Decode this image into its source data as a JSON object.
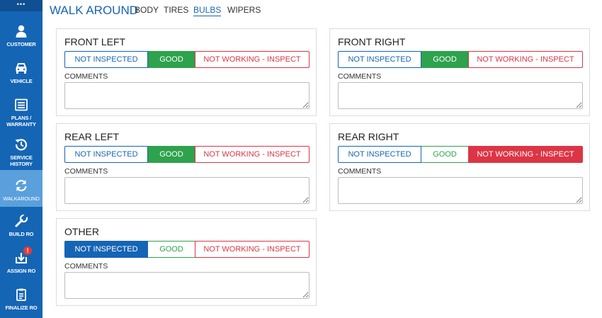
{
  "sidebar": {
    "top_glyph": "•••",
    "items": [
      {
        "label": "CUSTOMER",
        "icon": "user-icon",
        "active": false
      },
      {
        "label": "VEHICLE",
        "icon": "car-icon",
        "active": false
      },
      {
        "label": "PLANS / WARRANTY",
        "icon": "list-icon",
        "active": false
      },
      {
        "label": "SERVICE HISTORY",
        "icon": "history-icon",
        "active": false
      },
      {
        "label": "WALKAROUND",
        "icon": "refresh-icon",
        "active": true
      },
      {
        "label": "BUILD RO",
        "icon": "wrench-icon",
        "active": false
      },
      {
        "label": "ASSIGN RO",
        "icon": "download-box-icon",
        "active": false,
        "badge": "!"
      },
      {
        "label": "FINALIZE RO",
        "icon": "clipboard-icon",
        "active": false
      }
    ]
  },
  "header": {
    "title": "WALK AROUND",
    "tabs": [
      {
        "label": "BODY",
        "active": false
      },
      {
        "label": "TIRES",
        "active": false
      },
      {
        "label": "BULBS",
        "active": true
      },
      {
        "label": "WIPERS",
        "active": false
      }
    ]
  },
  "options": {
    "not_inspected": "NOT INSPECTED",
    "good": "GOOD",
    "not_working": "NOT WORKING - INSPECT"
  },
  "comments_label": "COMMENTS",
  "panels": [
    {
      "title": "FRONT LEFT",
      "selected": "good",
      "comment": ""
    },
    {
      "title": "FRONT RIGHT",
      "selected": "good",
      "comment": ""
    },
    {
      "title": "REAR LEFT",
      "selected": "good",
      "comment": ""
    },
    {
      "title": "REAR RIGHT",
      "selected": "not_working",
      "comment": ""
    },
    {
      "title": "OTHER",
      "selected": "not_inspected",
      "comment": ""
    }
  ],
  "colors": {
    "brand": "#1565b5",
    "good": "#2ea24d",
    "danger": "#dc3545",
    "active_nav": "#5aa0dc"
  }
}
